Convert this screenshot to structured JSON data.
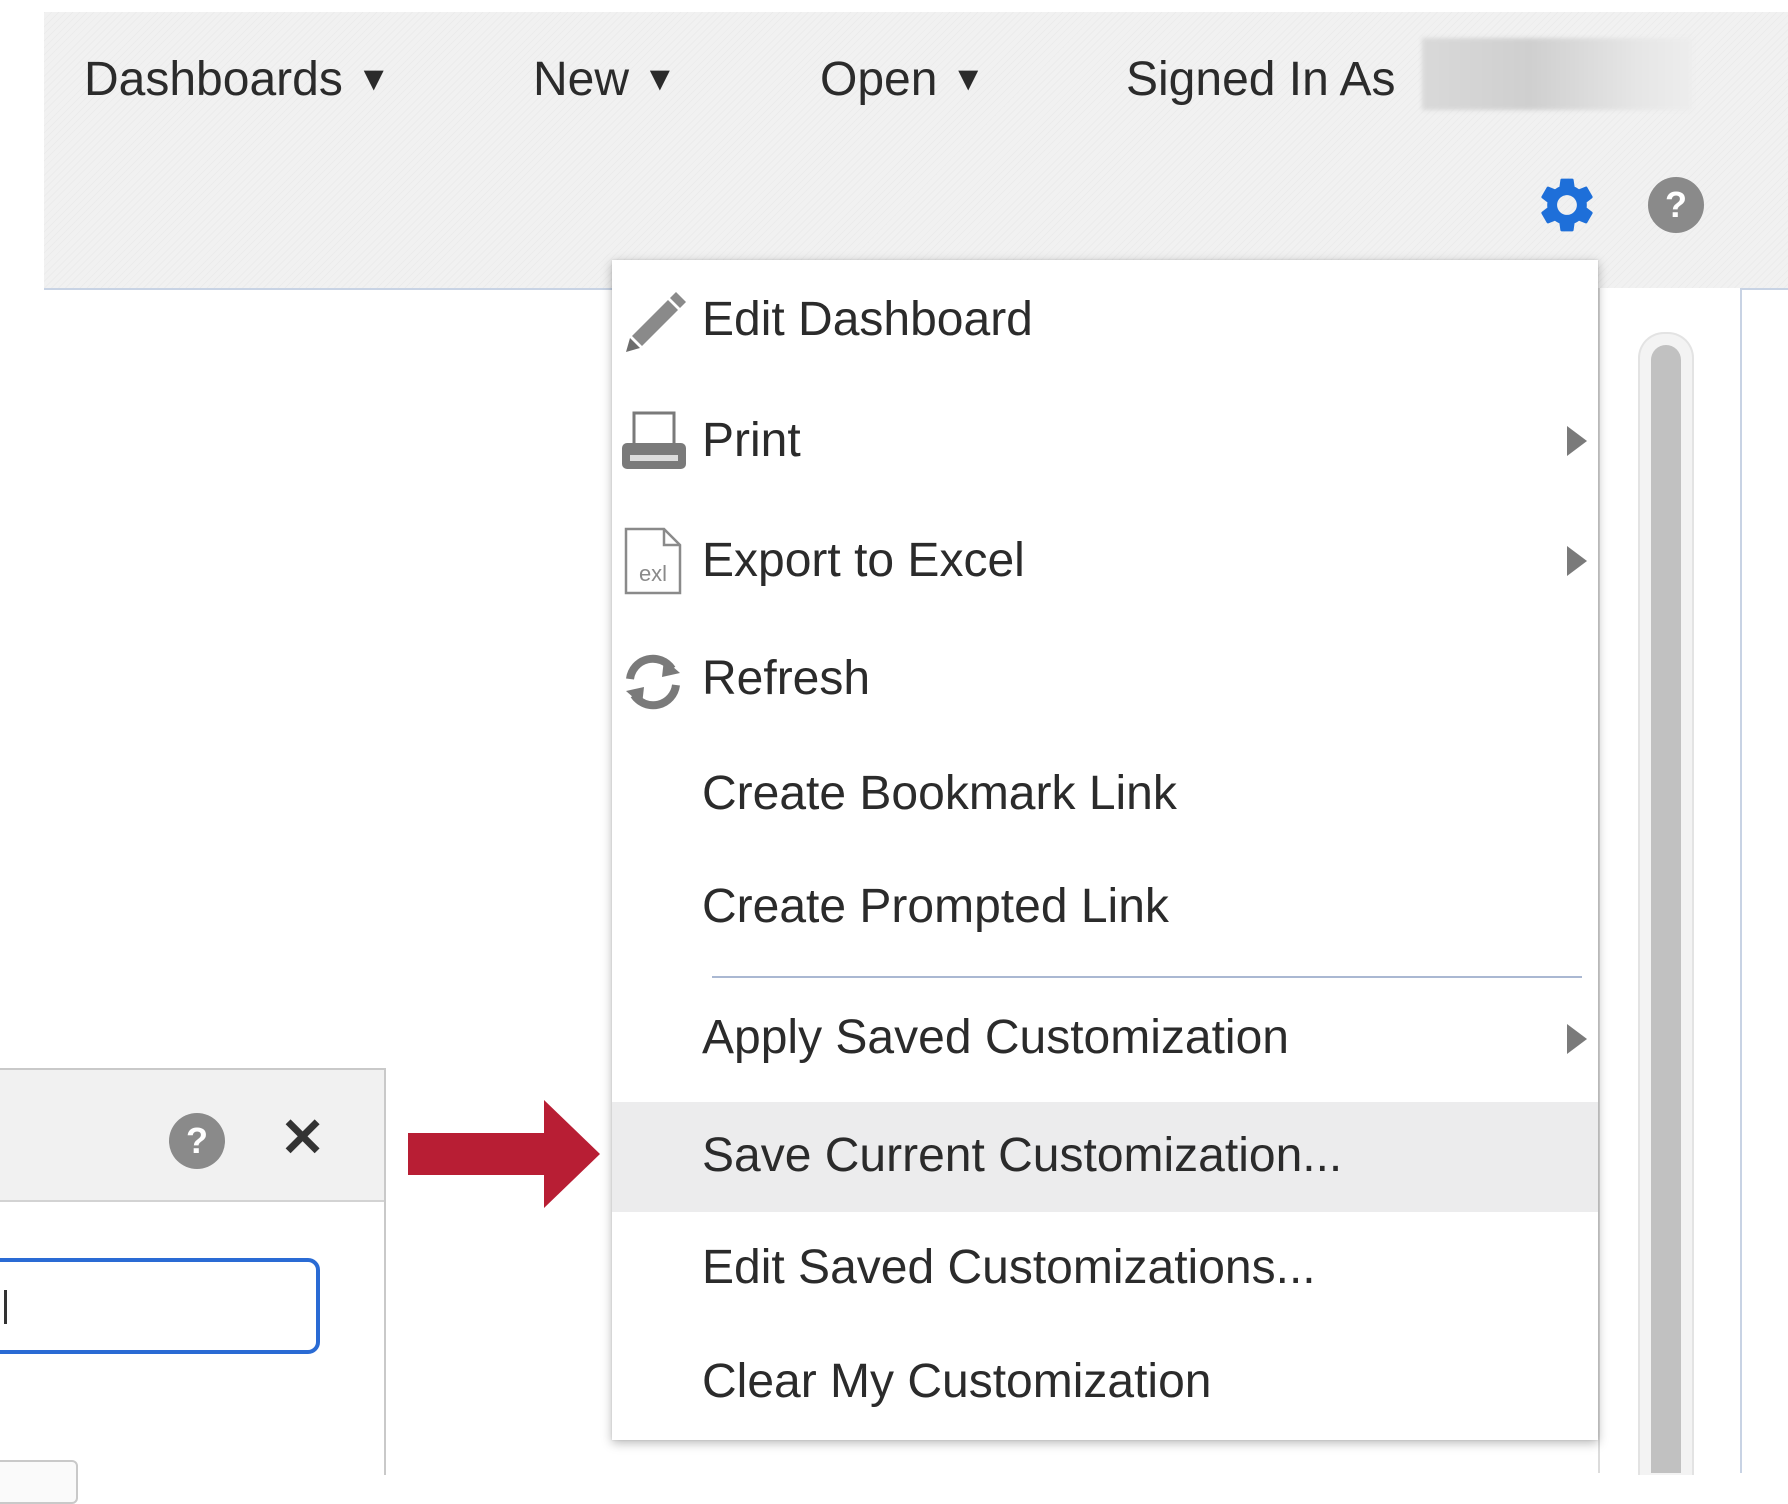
{
  "header": {
    "nav": [
      {
        "label": "Dashboards"
      },
      {
        "label": "New"
      },
      {
        "label": "Open"
      }
    ],
    "caret_glyph": "▼",
    "signed_in_label": "Signed In As",
    "settings_icon": "gear-icon",
    "help_icon": "help-icon",
    "accent_color": "#1e6fd9"
  },
  "menu": {
    "items": [
      {
        "label": "Edit Dashboard",
        "icon": "pencil-icon"
      },
      {
        "label": "Print",
        "icon": "printer-icon",
        "submenu": true
      },
      {
        "label": "Export to Excel",
        "icon": "excel-file-icon",
        "submenu": true
      },
      {
        "label": "Refresh",
        "icon": "refresh-icon"
      },
      {
        "label": "Create Bookmark Link"
      },
      {
        "label": "Create Prompted Link"
      },
      {
        "label": "Apply Saved Customization",
        "submenu": true
      },
      {
        "label": "Save Current Customization...",
        "highlighted": true
      },
      {
        "label": "Edit Saved Customizations..."
      },
      {
        "label": "Clear My Customization"
      }
    ],
    "excel_icon_text": "exl",
    "highlight_color": "#ececed"
  },
  "annotation": {
    "arrow_color": "#b81e34"
  },
  "dialog": {
    "help_icon": "help-icon",
    "close_glyph": "✕",
    "input_border_color": "#2a6bd4"
  }
}
